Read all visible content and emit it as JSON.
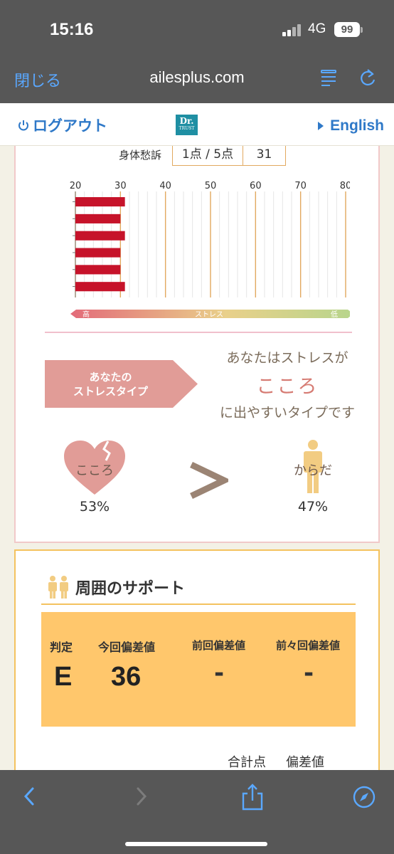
{
  "status_bar": {
    "time": "15:16",
    "network": "4G",
    "battery": "99"
  },
  "browser": {
    "close_label": "閉じる",
    "url": "ailesplus.com"
  },
  "site_header": {
    "logout_label": "ログアウト",
    "logo_line1": "Dr.",
    "logo_line2": "TRUST",
    "language_label": "English"
  },
  "score_row": {
    "label": "身体愁訴",
    "rating": "1点 / 5点",
    "value": "31"
  },
  "chart_data": {
    "type": "bar",
    "orientation": "horizontal",
    "x_ticks": [
      20,
      30,
      40,
      50,
      60,
      70,
      80
    ],
    "xlim": [
      20,
      80
    ],
    "values": [
      31,
      30,
      31,
      30,
      30,
      31
    ],
    "bar_color": "#c6132a",
    "gradient_left_label": "高",
    "gradient_center_label": "ストレス",
    "gradient_right_label": "低"
  },
  "stress_type": {
    "label_line1": "あなたの",
    "label_line2": "ストレスタイプ",
    "message_line1": "あなたはストレスが",
    "message_type": "こころ",
    "message_line3": "に出やすいタイプです"
  },
  "comparison": {
    "left_label": "こころ",
    "left_percent": "53%",
    "right_label": "からだ",
    "right_percent": "47%",
    "heart_color": "#e19c97",
    "body_color": "#f2cc82"
  },
  "support": {
    "title": "周囲のサポート",
    "headers": [
      "判定",
      "今回偏差値",
      "前回偏差値",
      "前々回偏差値"
    ],
    "values": [
      "E",
      "36",
      "-",
      "-"
    ],
    "sum_label": "合計点",
    "deviation_label": "偏差値"
  },
  "colors": {
    "link": "#2f79c8",
    "accent_orange": "#ffc76c",
    "chrome": "#575757"
  }
}
